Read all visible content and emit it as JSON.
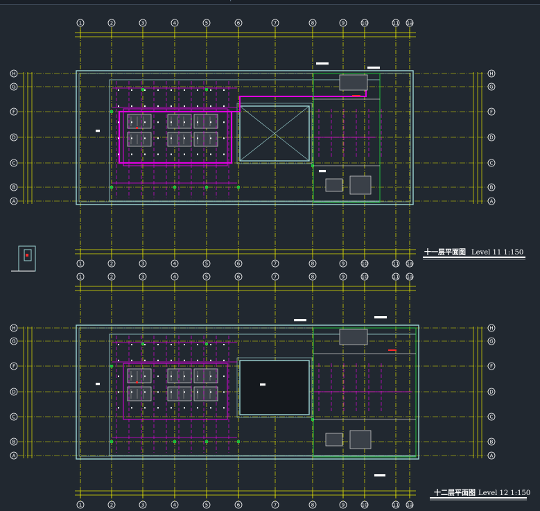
{
  "window": {
    "topbar_marker": "+"
  },
  "axes": {
    "columns": [
      "1",
      "2",
      "3",
      "4",
      "5",
      "6",
      "7",
      "8",
      "9",
      "10",
      "11",
      "1a"
    ],
    "rows": [
      "H",
      "G",
      "F",
      "D",
      "C",
      "B",
      "A"
    ]
  },
  "plans": [
    {
      "id": "level11",
      "title_cn": "十一层平面图",
      "title_en": "Level 11 1:150"
    },
    {
      "id": "level12",
      "title_cn": "十二层平面图",
      "title_en": "Level 12 1:150"
    }
  ],
  "colors": {
    "background": "#212830",
    "grid": "#e6e600",
    "wall": "#9fd6d6",
    "magenta": "#e000e0",
    "green": "#1fbf3a",
    "white": "#ffffff",
    "red": "#ff2a2a"
  }
}
